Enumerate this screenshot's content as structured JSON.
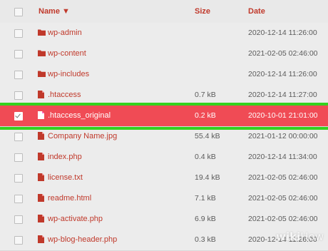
{
  "header": {
    "name_label": "Name ▼",
    "size_label": "Size",
    "date_label": "Date"
  },
  "files": [
    {
      "name": "wp-admin",
      "type": "folder",
      "size": "",
      "date": "2020-12-14 11:26:00"
    },
    {
      "name": "wp-content",
      "type": "folder",
      "size": "",
      "date": "2021-02-05 02:46:00"
    },
    {
      "name": "wp-includes",
      "type": "folder",
      "size": "",
      "date": "2020-12-14 11:26:00"
    },
    {
      "name": ".htaccess",
      "type": "file",
      "size": "0.7 kB",
      "date": "2020-12-14 11:27:00"
    },
    {
      "name": ".htaccess_original",
      "type": "file",
      "size": "0.2 kB",
      "date": "2020-10-01 21:01:00",
      "selected": true
    },
    {
      "name": "Company Name.jpg",
      "type": "file",
      "size": "55.4 kB",
      "date": "2021-01-12 00:00:00"
    },
    {
      "name": "index.php",
      "type": "file",
      "size": "0.4 kB",
      "date": "2020-12-14 11:34:00"
    },
    {
      "name": "license.txt",
      "type": "file",
      "size": "19.4 kB",
      "date": "2021-02-05 02:46:00"
    },
    {
      "name": "readme.html",
      "type": "file",
      "size": "7.1 kB",
      "date": "2021-02-05 02:46:00"
    },
    {
      "name": "wp-activate.php",
      "type": "file",
      "size": "6.9 kB",
      "date": "2021-02-05 02:46:00"
    },
    {
      "name": "wp-blog-header.php",
      "type": "file",
      "size": "0.3 kB",
      "date": "2020-12-14 11:26:00"
    }
  ],
  "watermark": {
    "bold": "wiki",
    "light": "How"
  },
  "colors": {
    "accent": "#c0392b",
    "selected_row": "#f04b55",
    "highlight_outline": "#35d21f"
  }
}
